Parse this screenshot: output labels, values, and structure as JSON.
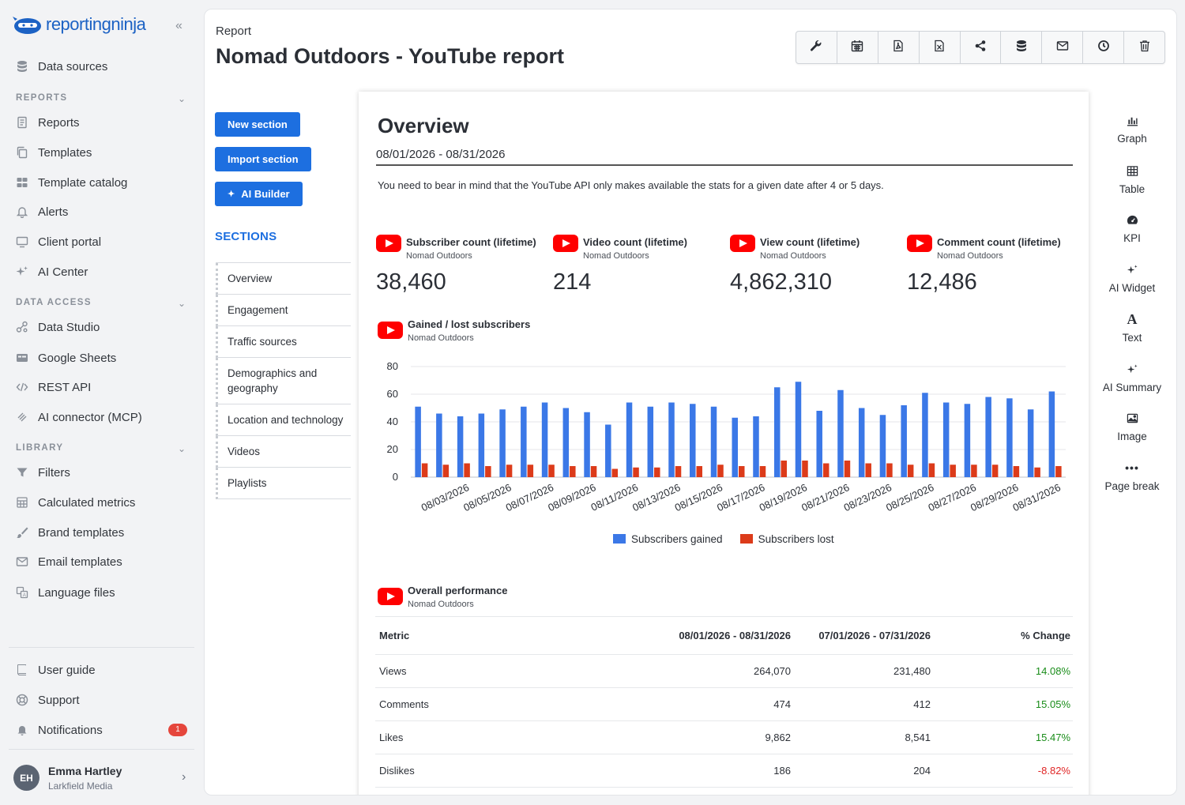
{
  "brand": {
    "name": "reportingninja",
    "accent": "#1d6fe0"
  },
  "sidebar": {
    "collapse_icon": "«",
    "top_items": [
      {
        "label": "Data sources",
        "icon": "database-icon"
      }
    ],
    "groups": [
      {
        "label": "REPORTS",
        "items": [
          {
            "label": "Reports",
            "icon": "document-icon"
          },
          {
            "label": "Templates",
            "icon": "copy-icon"
          },
          {
            "label": "Template catalog",
            "icon": "grid-icon"
          },
          {
            "label": "Alerts",
            "icon": "bell-icon"
          },
          {
            "label": "Client portal",
            "icon": "monitor-icon"
          },
          {
            "label": "AI Center",
            "icon": "sparkle-icon"
          }
        ]
      },
      {
        "label": "DATA ACCESS",
        "items": [
          {
            "label": "Data Studio",
            "icon": "nodes-icon"
          },
          {
            "label": "Google Sheets",
            "icon": "sheet-icon"
          },
          {
            "label": "REST API",
            "icon": "code-icon"
          },
          {
            "label": "AI connector (MCP)",
            "icon": "connector-icon"
          }
        ]
      },
      {
        "label": "LIBRARY",
        "items": [
          {
            "label": "Filters",
            "icon": "filter-icon"
          },
          {
            "label": "Calculated metrics",
            "icon": "calculator-icon"
          },
          {
            "label": "Brand templates",
            "icon": "brush-icon"
          },
          {
            "label": "Email templates",
            "icon": "mail-icon"
          },
          {
            "label": "Language files",
            "icon": "language-icon"
          }
        ]
      }
    ],
    "bottom_items": [
      {
        "label": "User guide",
        "icon": "book-icon"
      },
      {
        "label": "Support",
        "icon": "lifebuoy-icon"
      },
      {
        "label": "Notifications",
        "icon": "bell-icon",
        "badge": "1"
      }
    ],
    "user": {
      "initials": "EH",
      "name": "Emma Hartley",
      "org": "Larkfield Media"
    }
  },
  "header": {
    "breadcrumb": "Report",
    "title": "Nomad Outdoors - YouTube report"
  },
  "toolbar": [
    "wrench-icon",
    "calendar-icon",
    "pdf-icon",
    "excel-icon",
    "share-icon",
    "database-icon",
    "mail-icon",
    "clock-icon",
    "trash-icon"
  ],
  "editor": {
    "buttons": {
      "new_section": "New section",
      "import_section": "Import section",
      "ai_builder": "AI Builder"
    },
    "sections_title": "SECTIONS",
    "sections": [
      "Overview",
      "Engagement",
      "Traffic sources",
      "Demographics and geography",
      "Location and technology",
      "Videos",
      "Playlists"
    ]
  },
  "report": {
    "title": "Overview",
    "date_range": "08/01/2026 - 08/31/2026",
    "note": "You need to bear in mind that the YouTube API only makes available the stats for a given date after 4 or 5 days.",
    "kpis": [
      {
        "label": "Subscriber count (lifetime)",
        "source": "Nomad Outdoors",
        "value": "38,460"
      },
      {
        "label": "Video count (lifetime)",
        "source": "Nomad Outdoors",
        "value": "214"
      },
      {
        "label": "View count (lifetime)",
        "source": "Nomad Outdoors",
        "value": "4,862,310"
      },
      {
        "label": "Comment count (lifetime)",
        "source": "Nomad Outdoors",
        "value": "12,486"
      }
    ],
    "chart_widget": {
      "title": "Gained / lost subscribers",
      "source": "Nomad Outdoors"
    },
    "perf_widget": {
      "title": "Overall performance",
      "source": "Nomad Outdoors"
    },
    "perf_table": {
      "headers": [
        "Metric",
        "08/01/2026 - 08/31/2026",
        "07/01/2026 - 07/31/2026",
        "% Change"
      ],
      "rows": [
        [
          "Views",
          "264,070",
          "231,480",
          "14.08%"
        ],
        [
          "Comments",
          "474",
          "412",
          "15.05%"
        ],
        [
          "Likes",
          "9,862",
          "8,541",
          "15.47%"
        ],
        [
          "Dislikes",
          "186",
          "204",
          "-8.82%"
        ]
      ],
      "positive_color": "#1a8d1a",
      "negative_color": "#e02626"
    }
  },
  "palette": [
    {
      "label": "Graph",
      "icon": "bar-chart-icon"
    },
    {
      "label": "Table",
      "icon": "table-icon"
    },
    {
      "label": "KPI",
      "icon": "gauge-icon"
    },
    {
      "label": "AI Widget",
      "icon": "sparkle-icon"
    },
    {
      "label": "Text",
      "icon": "text-icon"
    },
    {
      "label": "AI Summary",
      "icon": "sparkle-icon"
    },
    {
      "label": "Image",
      "icon": "image-icon"
    },
    {
      "label": "Page break",
      "icon": "dots-icon"
    }
  ],
  "chart_data": {
    "type": "bar",
    "categories": [
      "08/01/2026",
      "08/02/2026",
      "08/03/2026",
      "08/04/2026",
      "08/05/2026",
      "08/06/2026",
      "08/07/2026",
      "08/08/2026",
      "08/09/2026",
      "08/10/2026",
      "08/11/2026",
      "08/12/2026",
      "08/13/2026",
      "08/14/2026",
      "08/15/2026",
      "08/16/2026",
      "08/17/2026",
      "08/18/2026",
      "08/19/2026",
      "08/20/2026",
      "08/21/2026",
      "08/22/2026",
      "08/23/2026",
      "08/24/2026",
      "08/25/2026",
      "08/26/2026",
      "08/27/2026",
      "08/28/2026",
      "08/29/2026",
      "08/30/2026",
      "08/31/2026"
    ],
    "tick_labels": [
      "08/03/2026",
      "08/05/2026",
      "08/07/2026",
      "08/09/2026",
      "08/11/2026",
      "08/13/2026",
      "08/15/2026",
      "08/17/2026",
      "08/19/2026",
      "08/21/2026",
      "08/23/2026",
      "08/25/2026",
      "08/27/2026",
      "08/29/2026",
      "08/31/2026"
    ],
    "series": [
      {
        "name": "Subscribers gained",
        "color": "#3b78e7",
        "values": [
          51,
          46,
          44,
          46,
          49,
          51,
          54,
          50,
          47,
          38,
          54,
          51,
          54,
          53,
          51,
          43,
          44,
          65,
          69,
          48,
          63,
          50,
          45,
          52,
          61,
          54,
          53,
          58,
          57,
          49,
          62
        ]
      },
      {
        "name": "Subscribers lost",
        "color": "#dc3b1a",
        "values": [
          10,
          9,
          10,
          8,
          9,
          9,
          9,
          8,
          8,
          6,
          7,
          7,
          8,
          8,
          9,
          8,
          8,
          12,
          12,
          10,
          12,
          10,
          10,
          9,
          10,
          9,
          9,
          9,
          8,
          7,
          8
        ]
      }
    ],
    "yticks": [
      0,
      20,
      40,
      60,
      80
    ],
    "ylim": [
      0,
      80
    ],
    "legend_position": "bottom",
    "grid": true
  }
}
